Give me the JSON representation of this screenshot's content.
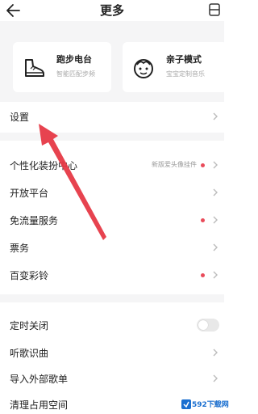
{
  "header": {
    "title": "更多"
  },
  "cards": [
    {
      "title": "跑步电台",
      "subtitle": "智能匹配步频",
      "icon": "running-shoe-icon"
    },
    {
      "title": "亲子模式",
      "subtitle": "宝宝定制音乐",
      "icon": "child-face-icon"
    }
  ],
  "settings": {
    "label": "设置"
  },
  "rows_group1": [
    {
      "label": "个性化装扮中心",
      "hint": "新版爱头像挂件",
      "dot": true
    },
    {
      "label": "开放平台",
      "hint": "",
      "dot": false
    },
    {
      "label": "免流量服务",
      "hint": "",
      "dot": true
    },
    {
      "label": "票务",
      "hint": "",
      "dot": false
    },
    {
      "label": "百变彩铃",
      "hint": "",
      "dot": true
    }
  ],
  "rows_group2": [
    {
      "label": "定时关闭",
      "toggle": false
    },
    {
      "label": "听歌识曲"
    },
    {
      "label": "导入外部歌单"
    },
    {
      "label": "清理占用空间"
    }
  ],
  "watermark": {
    "text": "592下载网"
  },
  "colors": {
    "accent_dot": "#e94b5a",
    "arrow": "#e63946",
    "background_gray": "#f5f5f6"
  }
}
